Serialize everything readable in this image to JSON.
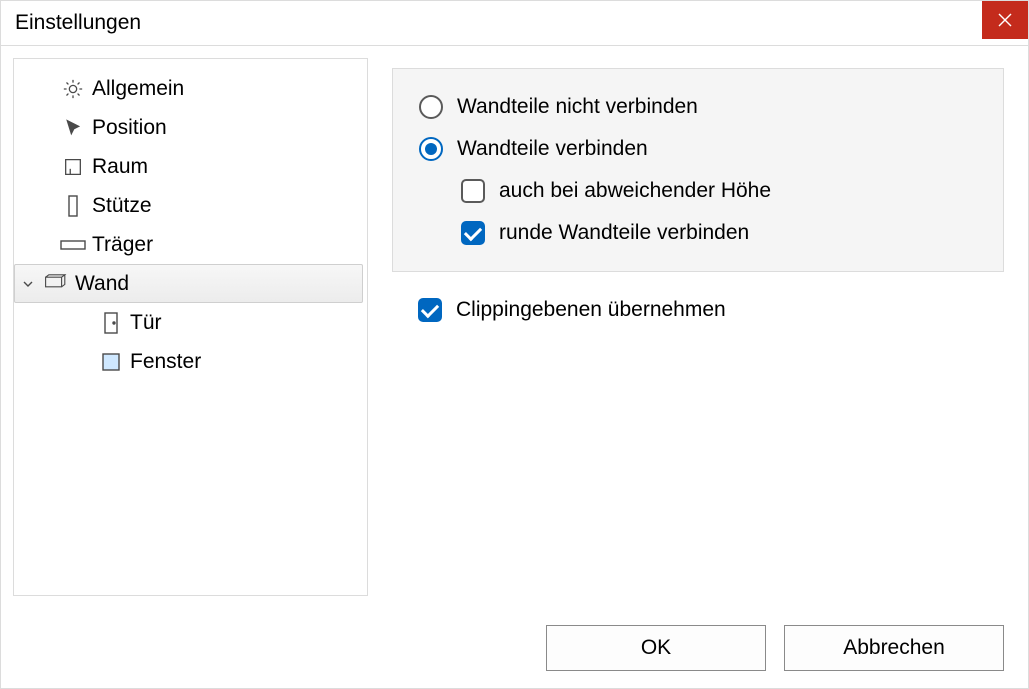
{
  "window": {
    "title": "Einstellungen"
  },
  "tree": {
    "items": [
      {
        "label": "Allgemein",
        "icon": "gear"
      },
      {
        "label": "Position",
        "icon": "cursor"
      },
      {
        "label": "Raum",
        "icon": "room"
      },
      {
        "label": "Stütze",
        "icon": "column"
      },
      {
        "label": "Träger",
        "icon": "beam"
      },
      {
        "label": "Wand",
        "icon": "wall",
        "selected": true,
        "children": [
          {
            "label": "Tür",
            "icon": "door"
          },
          {
            "label": "Fenster",
            "icon": "window"
          }
        ]
      }
    ]
  },
  "options": {
    "radio_no_connect": "Wandteile nicht verbinden",
    "radio_connect": "Wandteile verbinden",
    "chk_diff_height": "auch bei abweichender Höhe",
    "chk_round_connect": "runde Wandteile verbinden",
    "chk_clipping": "Clippingebenen übernehmen",
    "state": {
      "radio_selected": "connect",
      "diff_height": false,
      "round_connect": true,
      "clipping": true
    }
  },
  "buttons": {
    "ok": "OK",
    "cancel": "Abbrechen"
  }
}
